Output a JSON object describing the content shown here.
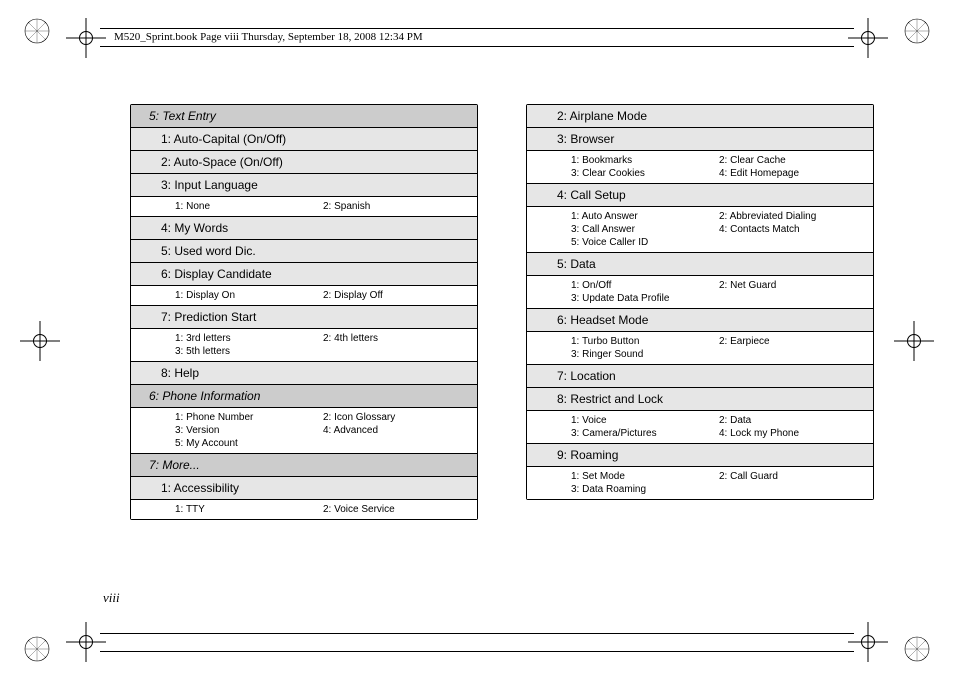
{
  "header": "M520_Sprint.book  Page viii  Thursday, September 18, 2008  12:34 PM",
  "page_number": "viii",
  "left_column": [
    {
      "type": "lvl1",
      "text": "5: Text Entry"
    },
    {
      "type": "lvl2",
      "text": "1: Auto-Capital (On/Off)"
    },
    {
      "type": "lvl2",
      "text": "2: Auto-Space (On/Off)"
    },
    {
      "type": "lvl2",
      "text": "3: Input Language"
    },
    {
      "type": "lvl3",
      "items": [
        "1: None",
        "2: Spanish"
      ]
    },
    {
      "type": "lvl2",
      "text": "4: My Words"
    },
    {
      "type": "lvl2",
      "text": "5: Used word Dic."
    },
    {
      "type": "lvl2",
      "text": "6: Display Candidate"
    },
    {
      "type": "lvl3",
      "items": [
        "1: Display On",
        "2: Display Off"
      ]
    },
    {
      "type": "lvl2",
      "text": "7: Prediction Start"
    },
    {
      "type": "lvl3",
      "items": [
        "1: 3rd letters",
        "2: 4th letters",
        "3: 5th letters"
      ]
    },
    {
      "type": "lvl2",
      "text": "8: Help"
    },
    {
      "type": "lvl1",
      "text": "6: Phone Information"
    },
    {
      "type": "lvl3",
      "items": [
        "1: Phone Number",
        "2: Icon Glossary",
        "3: Version",
        "4: Advanced",
        "5: My Account"
      ]
    },
    {
      "type": "lvl1",
      "text": "7: More..."
    },
    {
      "type": "lvl2",
      "text": "1: Accessibility"
    },
    {
      "type": "lvl3",
      "items": [
        "1: TTY",
        "2: Voice Service"
      ]
    }
  ],
  "right_column": [
    {
      "type": "lvl2",
      "text": "2: Airplane Mode"
    },
    {
      "type": "lvl2",
      "text": "3: Browser"
    },
    {
      "type": "lvl3",
      "items": [
        "1: Bookmarks",
        "2: Clear Cache",
        "3: Clear Cookies",
        "4: Edit Homepage"
      ]
    },
    {
      "type": "lvl2",
      "text": "4: Call Setup"
    },
    {
      "type": "lvl3",
      "items": [
        "1: Auto Answer",
        "2: Abbreviated Dialing",
        "3: Call Answer",
        "4: Contacts Match",
        "5: Voice Caller ID"
      ]
    },
    {
      "type": "lvl2",
      "text": "5: Data"
    },
    {
      "type": "lvl3",
      "items": [
        "1: On/Off",
        "2: Net Guard",
        "3: Update Data Profile"
      ]
    },
    {
      "type": "lvl2",
      "text": "6: Headset Mode"
    },
    {
      "type": "lvl3",
      "items": [
        "1: Turbo Button",
        "2: Earpiece",
        "3: Ringer Sound"
      ]
    },
    {
      "type": "lvl2",
      "text": "7: Location"
    },
    {
      "type": "lvl2",
      "text": "8: Restrict and Lock"
    },
    {
      "type": "lvl3",
      "items": [
        "1: Voice",
        "2: Data",
        "3: Camera/Pictures",
        "4: Lock my Phone"
      ]
    },
    {
      "type": "lvl2",
      "text": "9: Roaming"
    },
    {
      "type": "lvl3",
      "items": [
        "1: Set Mode",
        "2: Call Guard",
        "3: Data Roaming"
      ]
    }
  ]
}
